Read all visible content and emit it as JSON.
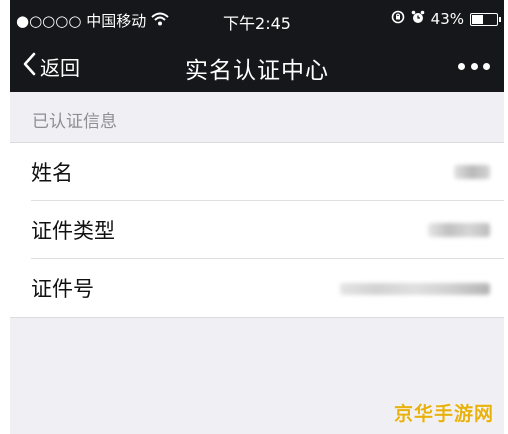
{
  "status_bar": {
    "carrier": "●○○○○ 中国移动",
    "time": "下午2:45",
    "battery_percent": "43%",
    "battery_level": 0.43,
    "icons": [
      "wifi-icon",
      "rotation-lock-icon",
      "alarm-icon",
      "battery-icon"
    ]
  },
  "nav": {
    "back_label": "返回",
    "title": "实名认证中心",
    "more_icon": "ellipsis-icon"
  },
  "section": {
    "header": "已认证信息"
  },
  "rows": [
    {
      "label": "姓名",
      "value_state": "blurred"
    },
    {
      "label": "证件类型",
      "value_state": "blurred"
    },
    {
      "label": "证件号",
      "value_state": "blurred"
    }
  ],
  "watermark": "京华手游网",
  "colors": {
    "bar_background": "#16171b",
    "page_background": "#efeff4",
    "watermark": "#e8b10e"
  }
}
